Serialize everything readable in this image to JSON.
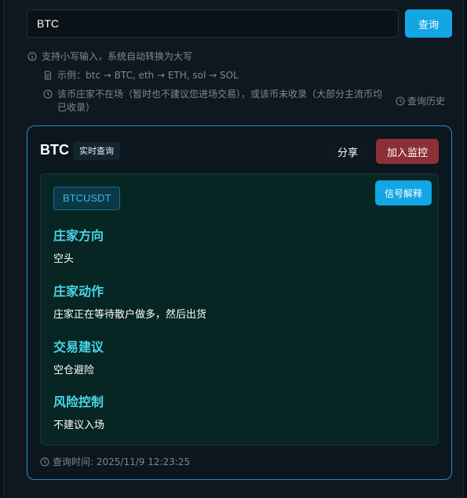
{
  "search": {
    "value": "BTC",
    "button_label": "查询"
  },
  "hints": {
    "line1": "支持小写输入，系统自动转换为大写",
    "line2": "示例：btc → BTC, eth → ETH, sol → SOL",
    "line3": "该币庄家不在场（暂时也不建议您进场交易），或该币未收录（大部分主流币均已收录）",
    "history_label": "查询历史"
  },
  "result": {
    "coin": "BTC",
    "live_badge": "实时查询",
    "share_label": "分享",
    "monitor_label": "加入监控",
    "pair": "BTCUSDT",
    "signal_label": "信号解释",
    "sections": [
      {
        "title": "庄家方向",
        "value": "空头"
      },
      {
        "title": "庄家动作",
        "value": "庄家正在等待散户做多，然后出货"
      },
      {
        "title": "交易建议",
        "value": "空仓避险"
      },
      {
        "title": "风险控制",
        "value": "不建议入场"
      }
    ],
    "query_time": "查询时间: 2025/11/9 12:23:25"
  },
  "colors": {
    "accent": "#12a6e4",
    "danger": "#8d2f37",
    "heading": "#4ad6e6",
    "card_border": "#1f8fd0"
  }
}
